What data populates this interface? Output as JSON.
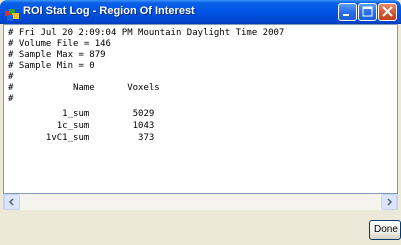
{
  "window": {
    "title": "ROI Stat Log - Region Of Interest",
    "icon": "color-palette-icon",
    "controls": [
      "minimize-icon",
      "maximize-icon",
      "close-icon"
    ]
  },
  "log": {
    "lines": [
      "# Fri Jul 20 2:09:04 PM Mountain Daylight Time 2007",
      "# Volume File = 146",
      "# Sample Max = 879",
      "# Sample Min = 0",
      "#",
      "#           Name      Voxels",
      "#",
      "          1_sum        5029",
      "         1c_sum        1043",
      "       1vC1_sum         373"
    ]
  },
  "buttons": {
    "done": "Done"
  },
  "colors": {
    "titlebar": "#0055e5",
    "close_button": "#d65a30",
    "log_background": "#ffffff"
  }
}
